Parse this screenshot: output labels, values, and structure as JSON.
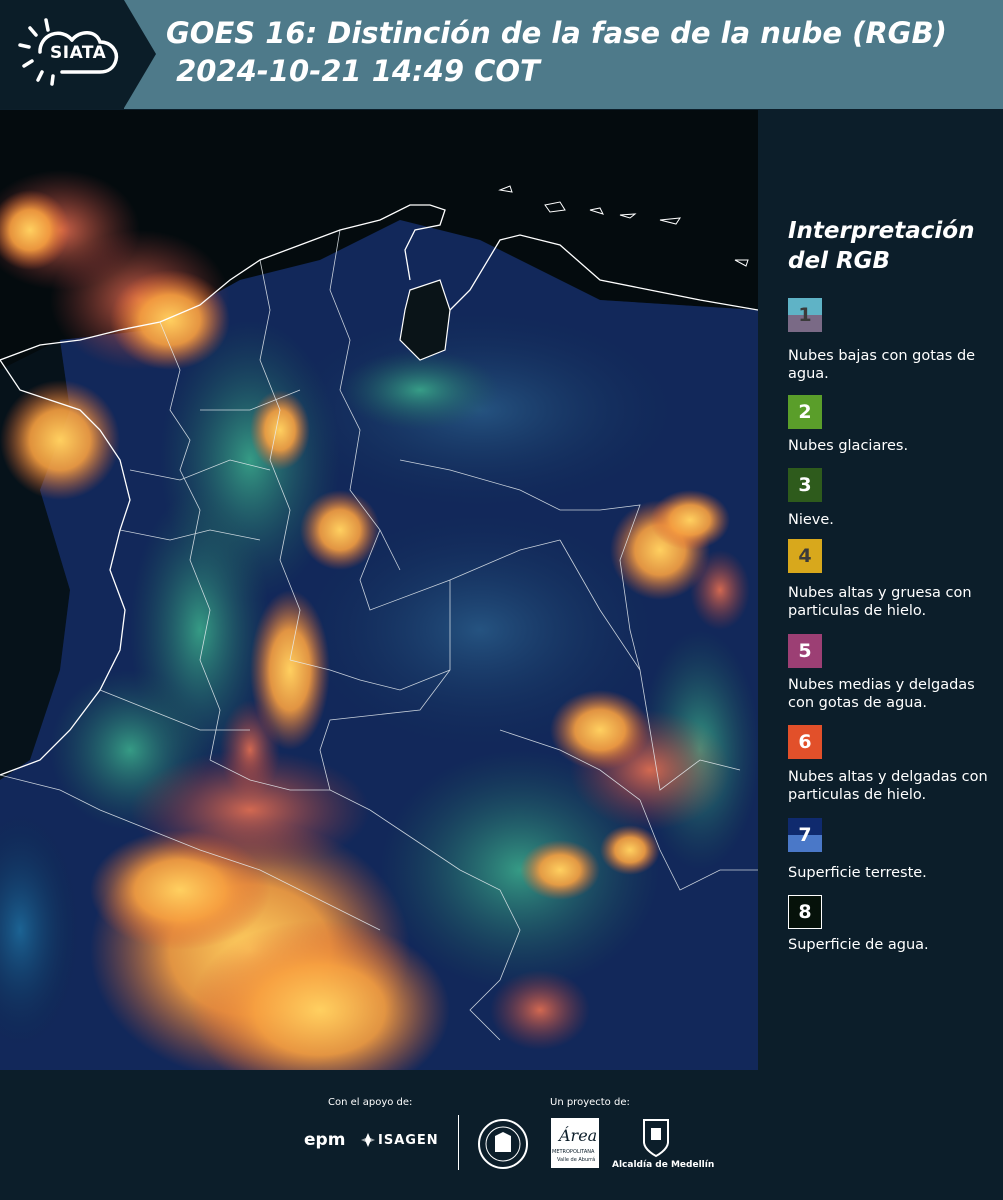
{
  "header": {
    "logo_text": "SIATA",
    "title_line1": "GOES 16: Distinción de la fase de la nube (RGB)",
    "title_line2": " 2024-10-21 14:49 COT"
  },
  "legend": {
    "title_line1": "Interpretación",
    "title_line2": "del RGB",
    "items": [
      {
        "num": "1",
        "label": "Nubes bajas con gotas de agua.",
        "color_top": "#5fb3c6",
        "color_bottom": "#7a6a86"
      },
      {
        "num": "2",
        "label": "Nubes glaciares.",
        "color": "#5a9e2a"
      },
      {
        "num": "3",
        "label": "Nieve.",
        "color": "#2e5b1c"
      },
      {
        "num": "4",
        "label": "Nubes altas y gruesa con particulas de hielo.",
        "color": "#d8a81c"
      },
      {
        "num": "5",
        "label": "Nubes medias y delgadas con gotas de agua.",
        "color": "#9c3f74"
      },
      {
        "num": "6",
        "label": "Nubes altas y delgadas con particulas de hielo.",
        "color": "#e2502a"
      },
      {
        "num": "7",
        "label": "Superficie terreste.",
        "color_top": "#0f2a6e",
        "color_bottom": "#4a78c8"
      },
      {
        "num": "8",
        "label": "Superficie de agua.",
        "color": "#06120a"
      }
    ]
  },
  "footer": {
    "support_label": "Con el apoyo de:",
    "project_label": "Un proyecto de:",
    "sponsor_1": "epm",
    "sponsor_2": "ISAGEN",
    "partner_1": "Área",
    "partner_1_sub1": "METROPOLITANA",
    "partner_1_sub2": "Valle de Aburrá",
    "partner_2": "Alcaldía de Medellín"
  }
}
